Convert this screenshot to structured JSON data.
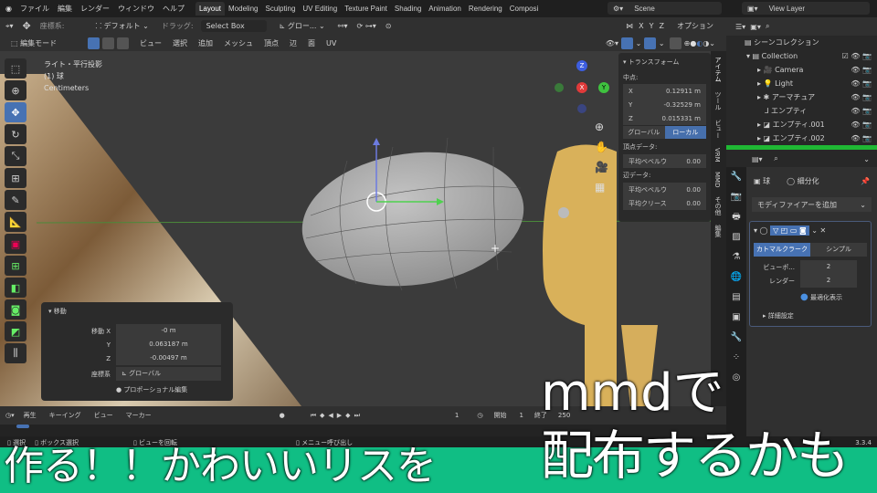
{
  "topbar": {
    "menus": [
      "ファイル",
      "編集",
      "レンダー",
      "ウィンドウ",
      "ヘルプ"
    ],
    "workspaces": [
      "Layout",
      "Modeling",
      "Sculpting",
      "UV Editing",
      "Texture Paint",
      "Shading",
      "Animation",
      "Rendering",
      "Composi"
    ],
    "active_workspace": "Layout",
    "scene": "Scene",
    "view_layer": "View Layer"
  },
  "header": {
    "coord_label": "座標系:",
    "pivot": "デフォルト",
    "drag_label": "ドラッグ:",
    "drag_value": "Select Box",
    "orientation": "グロー...",
    "x": "X",
    "y": "Y",
    "z": "Z",
    "options": "オプション",
    "mode": "編集モード",
    "menus": [
      "ビュー",
      "選択",
      "追加",
      "メッシュ",
      "頂点",
      "辺",
      "面",
      "UV"
    ]
  },
  "viewport": {
    "view_name": "ライト・平行投影",
    "object": "(1) 球",
    "units": "Centimeters",
    "gizmo": {
      "x": "X",
      "y": "Y",
      "z": "Z"
    }
  },
  "npanel": {
    "title": "トランスフォーム",
    "median_label": "中点:",
    "x_label": "X",
    "x": "0.12911 m",
    "y_label": "Y",
    "y": "-0.32529 m",
    "z_label": "Z",
    "z": "0.015331 m",
    "global": "グローバル",
    "local": "ローカル",
    "vertex_data": "頂点データ:",
    "bevel_weight": "平均ベベルウ",
    "vertex_bevel_value": "0.00",
    "edge_data": "辺データ:",
    "edge_bevel_value": "0.00",
    "crease": "平均クリース",
    "crease_value": "0.00"
  },
  "vtabs": [
    "アイテム",
    "ツール",
    "ビュー",
    "VRM",
    "MMD",
    "その他",
    "編集"
  ],
  "outliner": {
    "root": "シーンコレクション",
    "items": [
      {
        "name": "Collection",
        "icon": "collection"
      },
      {
        "name": "Camera",
        "icon": "camera"
      },
      {
        "name": "Light",
        "icon": "light"
      },
      {
        "name": "アーマチュア",
        "icon": "armature"
      },
      {
        "name": "エンプティ",
        "icon": "empty"
      },
      {
        "name": "エンプティ.001",
        "icon": "image"
      },
      {
        "name": "エンプティ.002",
        "icon": "image"
      }
    ]
  },
  "properties": {
    "object": "球",
    "modifier_name": "細分化",
    "add_modifier": "モディファイアーを追加",
    "catmull": "カトマルクラーク",
    "simple": "シンプル",
    "viewport_label": "ビューポ...",
    "viewport_value": "2",
    "render_label": "レンダー",
    "render_value": "2",
    "optimal": "最適化表示",
    "advanced": "詳細設定"
  },
  "operator": {
    "title": "移動",
    "move_x_label": "移動 X",
    "x": "-0 m",
    "y_label": "Y",
    "y": "0.063187 m",
    "z_label": "Z",
    "z": "-0.00497 m",
    "orient_label": "座標系",
    "orient": "グローバル",
    "proportional": "プロポーショナル編集"
  },
  "timeline": {
    "menus": [
      "再生",
      "キーイング",
      "ビュー",
      "マーカー"
    ],
    "current": "1",
    "start_label": "開始",
    "start": "1",
    "end_label": "終了",
    "end": "250"
  },
  "status": {
    "select": "選択",
    "box_select": "ボックス選択",
    "rotate": "ビューを回転",
    "menu": "メニュー呼び出し",
    "version": "3.3.4"
  },
  "subtitles": {
    "line1_right": "mmdで",
    "line2_left": "作る！！かわいいリスを",
    "line2_right": "配布するかも"
  },
  "colors": {
    "accent": "#4772b3",
    "subtitle_bar": "#10be84",
    "outliner_highlight": "#1fb834"
  }
}
